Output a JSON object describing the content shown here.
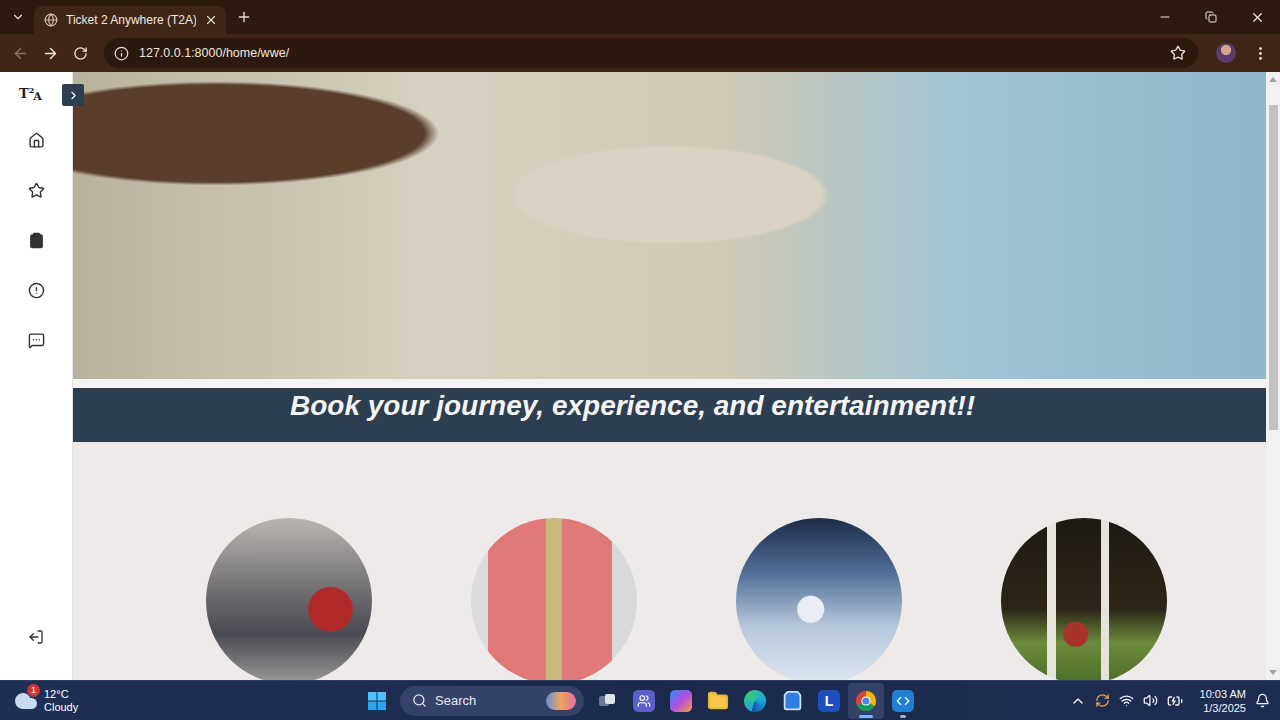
{
  "browser": {
    "tabs": [
      {
        "label": "Ticket 2 Anywhere (T2A)",
        "selected": true
      }
    ],
    "navigation": {
      "back": {
        "disabled": true
      },
      "forward": {
        "disabled": false
      }
    },
    "address": "127.0.0.1:8000/home/wwe/",
    "bookmarked": false
  },
  "sidebar": {
    "logo": {
      "letter1": "T",
      "superscript": "2",
      "letter2": "A"
    },
    "expanded": false,
    "items": [
      {
        "kind": "home",
        "selected": false
      },
      {
        "kind": "favorites",
        "selected": false
      },
      {
        "kind": "bookings",
        "selected": false
      },
      {
        "kind": "about",
        "selected": false
      },
      {
        "kind": "feedback",
        "selected": false
      }
    ],
    "footer": {
      "kind": "logout"
    }
  },
  "banner": {
    "text": "Book your journey, experience, and entertainment!!"
  },
  "cards": [
    {
      "kind": "bus"
    },
    {
      "kind": "train"
    },
    {
      "kind": "plane"
    },
    {
      "kind": "cricket"
    }
  ],
  "taskbar": {
    "weather": {
      "temperature": "12°C",
      "condition": "Cloudy",
      "badge": "1"
    },
    "search": {
      "placeholder": "Search"
    },
    "apps": [
      {
        "kind": "task-view",
        "label": "",
        "active": false,
        "running": false
      },
      {
        "kind": "teams",
        "label": "",
        "active": false,
        "running": false
      },
      {
        "kind": "copilot",
        "label": "",
        "active": false,
        "running": false
      },
      {
        "kind": "explorer",
        "label": "",
        "active": false,
        "running": false
      },
      {
        "kind": "edge",
        "label": "",
        "active": false,
        "running": false
      },
      {
        "kind": "store",
        "label": "",
        "active": false,
        "running": false
      },
      {
        "kind": "letter",
        "label": "L",
        "active": false,
        "running": false
      },
      {
        "kind": "chrome",
        "label": "",
        "active": true,
        "running": true
      },
      {
        "kind": "vscode",
        "label": "",
        "active": false,
        "running": true
      }
    ],
    "clock": {
      "time": "10:03 AM",
      "date": "1/3/2025"
    }
  }
}
